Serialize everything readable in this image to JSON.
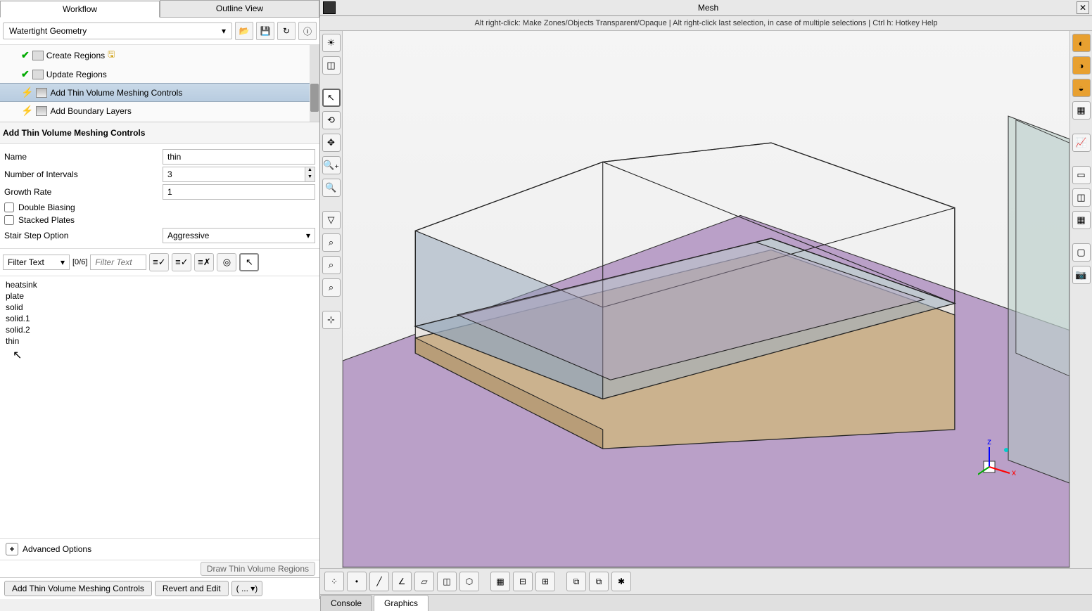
{
  "tabs": {
    "workflow": "Workflow",
    "outline": "Outline View"
  },
  "workflow_select": "Watertight Geometry",
  "tree": {
    "create_regions": "Create Regions",
    "update_regions": "Update Regions",
    "add_thin": "Add Thin Volume Meshing Controls",
    "add_boundary": "Add Boundary Layers"
  },
  "section_title": "Add Thin Volume Meshing Controls",
  "form": {
    "name_label": "Name",
    "name_value": "thin",
    "intervals_label": "Number of Intervals",
    "intervals_value": "3",
    "growth_label": "Growth Rate",
    "growth_value": "1",
    "double_biasing": "Double Biasing",
    "stacked_plates": "Stacked Plates",
    "stair_label": "Stair Step Option",
    "stair_value": "Aggressive"
  },
  "filter": {
    "dd": "Filter Text",
    "count": "[0/6]",
    "placeholder": "Filter Text"
  },
  "list_items": [
    "heatsink",
    "plate",
    "solid",
    "solid.1",
    "solid.2",
    "thin"
  ],
  "advanced": "Advanced Options",
  "draw_btn": "Draw Thin Volume Regions",
  "bottom": {
    "add": "Add Thin Volume Meshing Controls",
    "revert": "Revert and Edit",
    "dots": "(   ...   ▾)"
  },
  "mesh": {
    "title": "Mesh",
    "hint": "Alt right-click: Make Zones/Objects Transparent/Opaque | Alt right-click last selection, in case of multiple selections | Ctrl h: Hotkey Help"
  },
  "btabs": {
    "console": "Console",
    "graphics": "Graphics"
  }
}
